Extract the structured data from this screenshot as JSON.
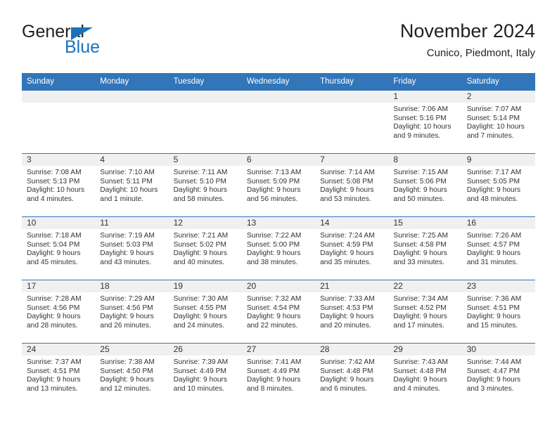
{
  "logo": {
    "word_top": "General",
    "word_bottom": "Blue",
    "triangle_icon": "triangle-icon",
    "accent_color": "#1c71bc"
  },
  "header": {
    "title": "November 2024",
    "subtitle": "Cunico, Piedmont, Italy"
  },
  "calendar": {
    "header_bg": "#3275b9",
    "daynum_bg": "#f0f0f0",
    "weekday_headers": [
      "Sunday",
      "Monday",
      "Tuesday",
      "Wednesday",
      "Thursday",
      "Friday",
      "Saturday"
    ],
    "weeks": [
      [
        {
          "day": "",
          "empty": true,
          "sunrise": "",
          "sunset": "",
          "daylight_1": "",
          "daylight_2": ""
        },
        {
          "day": "",
          "empty": true,
          "sunrise": "",
          "sunset": "",
          "daylight_1": "",
          "daylight_2": ""
        },
        {
          "day": "",
          "empty": true,
          "sunrise": "",
          "sunset": "",
          "daylight_1": "",
          "daylight_2": ""
        },
        {
          "day": "",
          "empty": true,
          "sunrise": "",
          "sunset": "",
          "daylight_1": "",
          "daylight_2": ""
        },
        {
          "day": "",
          "empty": true,
          "sunrise": "",
          "sunset": "",
          "daylight_1": "",
          "daylight_2": ""
        },
        {
          "day": "1",
          "empty": false,
          "sunrise": "Sunrise: 7:06 AM",
          "sunset": "Sunset: 5:16 PM",
          "daylight_1": "Daylight: 10 hours",
          "daylight_2": "and 9 minutes."
        },
        {
          "day": "2",
          "empty": false,
          "sunrise": "Sunrise: 7:07 AM",
          "sunset": "Sunset: 5:14 PM",
          "daylight_1": "Daylight: 10 hours",
          "daylight_2": "and 7 minutes."
        }
      ],
      [
        {
          "day": "3",
          "empty": false,
          "sunrise": "Sunrise: 7:08 AM",
          "sunset": "Sunset: 5:13 PM",
          "daylight_1": "Daylight: 10 hours",
          "daylight_2": "and 4 minutes."
        },
        {
          "day": "4",
          "empty": false,
          "sunrise": "Sunrise: 7:10 AM",
          "sunset": "Sunset: 5:11 PM",
          "daylight_1": "Daylight: 10 hours",
          "daylight_2": "and 1 minute."
        },
        {
          "day": "5",
          "empty": false,
          "sunrise": "Sunrise: 7:11 AM",
          "sunset": "Sunset: 5:10 PM",
          "daylight_1": "Daylight: 9 hours",
          "daylight_2": "and 58 minutes."
        },
        {
          "day": "6",
          "empty": false,
          "sunrise": "Sunrise: 7:13 AM",
          "sunset": "Sunset: 5:09 PM",
          "daylight_1": "Daylight: 9 hours",
          "daylight_2": "and 56 minutes."
        },
        {
          "day": "7",
          "empty": false,
          "sunrise": "Sunrise: 7:14 AM",
          "sunset": "Sunset: 5:08 PM",
          "daylight_1": "Daylight: 9 hours",
          "daylight_2": "and 53 minutes."
        },
        {
          "day": "8",
          "empty": false,
          "sunrise": "Sunrise: 7:15 AM",
          "sunset": "Sunset: 5:06 PM",
          "daylight_1": "Daylight: 9 hours",
          "daylight_2": "and 50 minutes."
        },
        {
          "day": "9",
          "empty": false,
          "sunrise": "Sunrise: 7:17 AM",
          "sunset": "Sunset: 5:05 PM",
          "daylight_1": "Daylight: 9 hours",
          "daylight_2": "and 48 minutes."
        }
      ],
      [
        {
          "day": "10",
          "empty": false,
          "sunrise": "Sunrise: 7:18 AM",
          "sunset": "Sunset: 5:04 PM",
          "daylight_1": "Daylight: 9 hours",
          "daylight_2": "and 45 minutes."
        },
        {
          "day": "11",
          "empty": false,
          "sunrise": "Sunrise: 7:19 AM",
          "sunset": "Sunset: 5:03 PM",
          "daylight_1": "Daylight: 9 hours",
          "daylight_2": "and 43 minutes."
        },
        {
          "day": "12",
          "empty": false,
          "sunrise": "Sunrise: 7:21 AM",
          "sunset": "Sunset: 5:02 PM",
          "daylight_1": "Daylight: 9 hours",
          "daylight_2": "and 40 minutes."
        },
        {
          "day": "13",
          "empty": false,
          "sunrise": "Sunrise: 7:22 AM",
          "sunset": "Sunset: 5:00 PM",
          "daylight_1": "Daylight: 9 hours",
          "daylight_2": "and 38 minutes."
        },
        {
          "day": "14",
          "empty": false,
          "sunrise": "Sunrise: 7:24 AM",
          "sunset": "Sunset: 4:59 PM",
          "daylight_1": "Daylight: 9 hours",
          "daylight_2": "and 35 minutes."
        },
        {
          "day": "15",
          "empty": false,
          "sunrise": "Sunrise: 7:25 AM",
          "sunset": "Sunset: 4:58 PM",
          "daylight_1": "Daylight: 9 hours",
          "daylight_2": "and 33 minutes."
        },
        {
          "day": "16",
          "empty": false,
          "sunrise": "Sunrise: 7:26 AM",
          "sunset": "Sunset: 4:57 PM",
          "daylight_1": "Daylight: 9 hours",
          "daylight_2": "and 31 minutes."
        }
      ],
      [
        {
          "day": "17",
          "empty": false,
          "sunrise": "Sunrise: 7:28 AM",
          "sunset": "Sunset: 4:56 PM",
          "daylight_1": "Daylight: 9 hours",
          "daylight_2": "and 28 minutes."
        },
        {
          "day": "18",
          "empty": false,
          "sunrise": "Sunrise: 7:29 AM",
          "sunset": "Sunset: 4:56 PM",
          "daylight_1": "Daylight: 9 hours",
          "daylight_2": "and 26 minutes."
        },
        {
          "day": "19",
          "empty": false,
          "sunrise": "Sunrise: 7:30 AM",
          "sunset": "Sunset: 4:55 PM",
          "daylight_1": "Daylight: 9 hours",
          "daylight_2": "and 24 minutes."
        },
        {
          "day": "20",
          "empty": false,
          "sunrise": "Sunrise: 7:32 AM",
          "sunset": "Sunset: 4:54 PM",
          "daylight_1": "Daylight: 9 hours",
          "daylight_2": "and 22 minutes."
        },
        {
          "day": "21",
          "empty": false,
          "sunrise": "Sunrise: 7:33 AM",
          "sunset": "Sunset: 4:53 PM",
          "daylight_1": "Daylight: 9 hours",
          "daylight_2": "and 20 minutes."
        },
        {
          "day": "22",
          "empty": false,
          "sunrise": "Sunrise: 7:34 AM",
          "sunset": "Sunset: 4:52 PM",
          "daylight_1": "Daylight: 9 hours",
          "daylight_2": "and 17 minutes."
        },
        {
          "day": "23",
          "empty": false,
          "sunrise": "Sunrise: 7:36 AM",
          "sunset": "Sunset: 4:51 PM",
          "daylight_1": "Daylight: 9 hours",
          "daylight_2": "and 15 minutes."
        }
      ],
      [
        {
          "day": "24",
          "empty": false,
          "sunrise": "Sunrise: 7:37 AM",
          "sunset": "Sunset: 4:51 PM",
          "daylight_1": "Daylight: 9 hours",
          "daylight_2": "and 13 minutes."
        },
        {
          "day": "25",
          "empty": false,
          "sunrise": "Sunrise: 7:38 AM",
          "sunset": "Sunset: 4:50 PM",
          "daylight_1": "Daylight: 9 hours",
          "daylight_2": "and 12 minutes."
        },
        {
          "day": "26",
          "empty": false,
          "sunrise": "Sunrise: 7:39 AM",
          "sunset": "Sunset: 4:49 PM",
          "daylight_1": "Daylight: 9 hours",
          "daylight_2": "and 10 minutes."
        },
        {
          "day": "27",
          "empty": false,
          "sunrise": "Sunrise: 7:41 AM",
          "sunset": "Sunset: 4:49 PM",
          "daylight_1": "Daylight: 9 hours",
          "daylight_2": "and 8 minutes."
        },
        {
          "day": "28",
          "empty": false,
          "sunrise": "Sunrise: 7:42 AM",
          "sunset": "Sunset: 4:48 PM",
          "daylight_1": "Daylight: 9 hours",
          "daylight_2": "and 6 minutes."
        },
        {
          "day": "29",
          "empty": false,
          "sunrise": "Sunrise: 7:43 AM",
          "sunset": "Sunset: 4:48 PM",
          "daylight_1": "Daylight: 9 hours",
          "daylight_2": "and 4 minutes."
        },
        {
          "day": "30",
          "empty": false,
          "sunrise": "Sunrise: 7:44 AM",
          "sunset": "Sunset: 4:47 PM",
          "daylight_1": "Daylight: 9 hours",
          "daylight_2": "and 3 minutes."
        }
      ]
    ]
  }
}
